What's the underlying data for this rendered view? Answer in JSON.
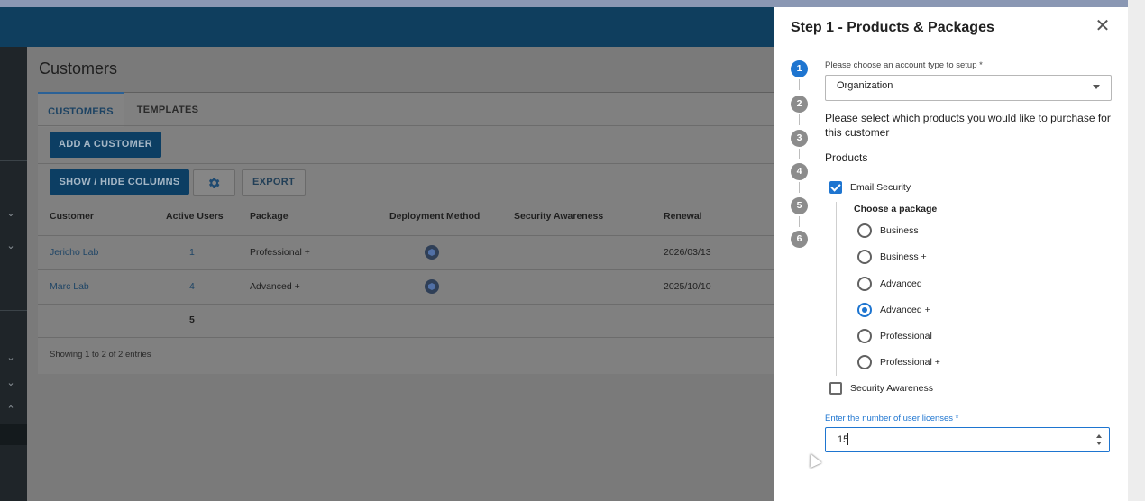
{
  "app": {
    "page_title": "Customers",
    "tabs": [
      {
        "label": "CUSTOMERS",
        "active": true
      },
      {
        "label": "TEMPLATES",
        "active": false
      }
    ],
    "buttons": {
      "add_customer": "ADD A CUSTOMER",
      "show_hide_columns": "SHOW / HIDE COLUMNS",
      "export": "EXPORT"
    },
    "table": {
      "headers": [
        "Customer",
        "Active Users",
        "Package",
        "Deployment Method",
        "Security Awareness",
        "Renewal"
      ],
      "rows": [
        {
          "customer": "Jericho Lab",
          "active_users": "1",
          "package": "Professional +",
          "security_awareness": "",
          "renewal": "2026/03/13"
        },
        {
          "customer": "Marc Lab",
          "active_users": "4",
          "package": "Advanced +",
          "security_awareness": "",
          "renewal": "2025/10/10"
        }
      ],
      "total_users": "5",
      "footer": "Showing 1 to 2 of 2 entries"
    }
  },
  "panel": {
    "title": "Step 1 - Products & Packages",
    "steps": [
      "1",
      "2",
      "3",
      "4",
      "5",
      "6"
    ],
    "account_type": {
      "label": "Please choose an account type to setup *",
      "value": "Organization"
    },
    "prompt": "Please select which products you would like to purchase for this customer",
    "products_heading": "Products",
    "products": {
      "email_security": {
        "label": "Email Security",
        "checked": true
      },
      "security_awareness": {
        "label": "Security Awareness",
        "checked": false
      }
    },
    "package": {
      "label": "Choose a package",
      "options": [
        "Business",
        "Business +",
        "Advanced",
        "Advanced +",
        "Professional",
        "Professional +"
      ],
      "selected": "Advanced +"
    },
    "licenses": {
      "label": "Enter the number of user licenses *",
      "value": "15"
    }
  },
  "colors": {
    "accent": "#1e75d0",
    "app_bar": "#0f3e5e",
    "nav": "#1f2529"
  }
}
